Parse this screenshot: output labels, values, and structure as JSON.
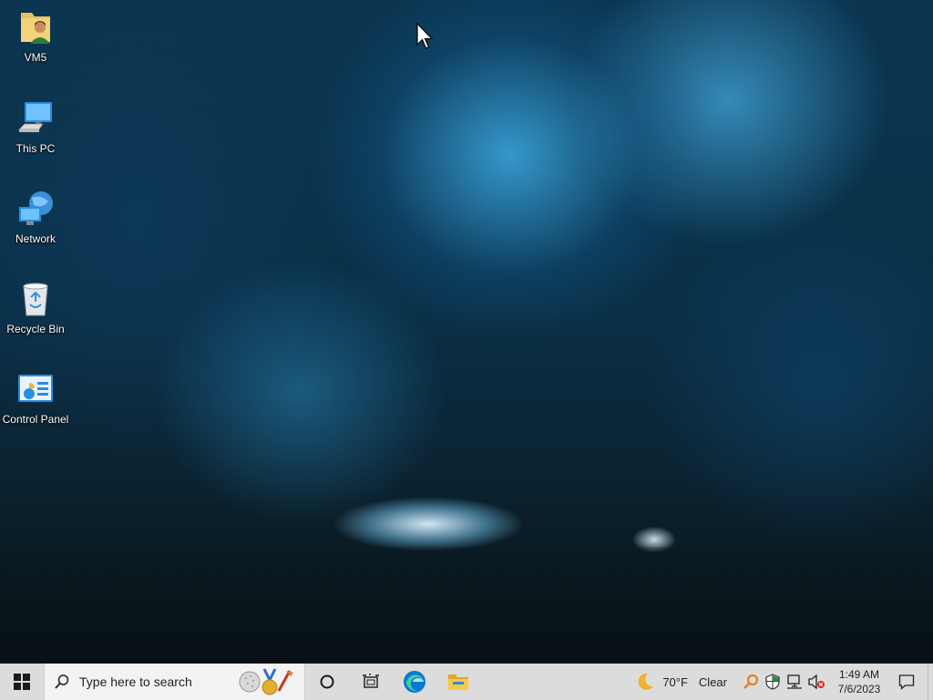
{
  "desktop": {
    "icons": [
      {
        "label": "VM5",
        "icon": "user-folder-icon"
      },
      {
        "label": "This PC",
        "icon": "computer-icon"
      },
      {
        "label": "Network",
        "icon": "network-icon"
      },
      {
        "label": "Recycle Bin",
        "icon": "recycle-bin-icon"
      },
      {
        "label": "Control Panel",
        "icon": "control-panel-icon"
      }
    ]
  },
  "taskbar": {
    "search_placeholder": "Type here to search",
    "apps": [
      {
        "name": "Cortana",
        "icon": "cortana-circle-icon"
      },
      {
        "name": "Task View",
        "icon": "task-view-icon"
      },
      {
        "name": "Microsoft Edge",
        "icon": "edge-icon"
      },
      {
        "name": "File Explorer",
        "icon": "folder-icon"
      }
    ],
    "weather": {
      "temp": "70°F",
      "condition": "Clear",
      "icon": "moon-icon"
    },
    "clock": {
      "time": "1:49 AM",
      "date": "7/6/2023"
    },
    "colors": {
      "taskbar_bg": "#dcdcdc",
      "start_icon": "#1a1a1a"
    }
  }
}
